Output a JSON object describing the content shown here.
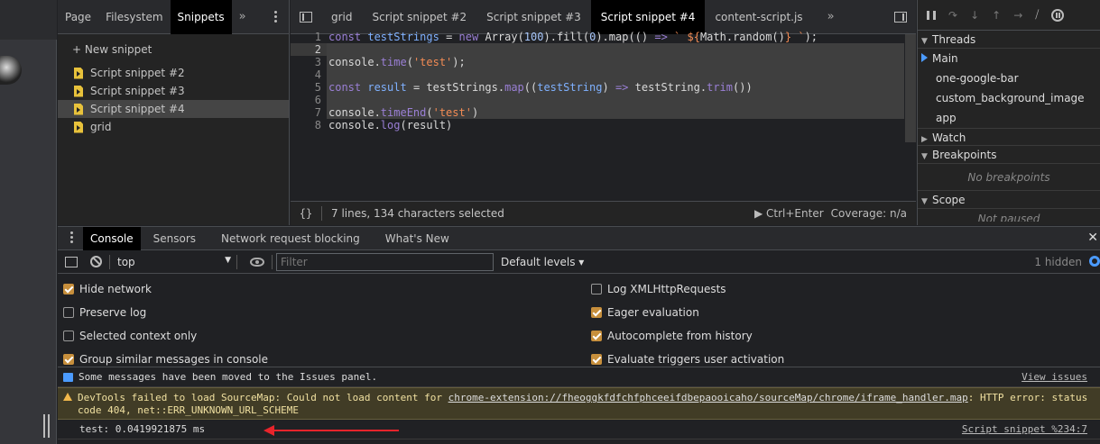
{
  "navigator": {
    "tabs": [
      "Page",
      "Filesystem",
      "Snippets"
    ],
    "active_tab": "Snippets",
    "new_snippet": "+ New snippet",
    "snippets": [
      "Script snippet #2",
      "Script snippet #3",
      "Script snippet #4",
      "grid"
    ],
    "selected_snippet": "Script snippet #4"
  },
  "editor": {
    "tabs": [
      "grid",
      "Script snippet #2",
      "Script snippet #3",
      "Script snippet #4",
      "content-script.js"
    ],
    "active_tab": "Script snippet #4",
    "line_numbers": [
      "1",
      "2",
      "3",
      "4",
      "5",
      "6",
      "7",
      "8"
    ],
    "status": {
      "braces": "{}",
      "selection": "7 lines, 134 characters selected",
      "run": "Ctrl+Enter",
      "coverage": "Coverage: n/a"
    }
  },
  "debugger": {
    "threads_label": "Threads",
    "threads": [
      "Main",
      "one-google-bar",
      "custom_background_image",
      "app"
    ],
    "watch_label": "Watch",
    "breakpoints_label": "Breakpoints",
    "no_breakpoints": "No breakpoints",
    "scope_label": "Scope",
    "not_paused": "Not paused"
  },
  "drawer": {
    "tabs": [
      "Console",
      "Sensors",
      "Network request blocking",
      "What's New"
    ],
    "active_tab": "Console",
    "context": "top",
    "filter_placeholder": "Filter",
    "levels": "Default levels ▾",
    "hidden": "1 hidden",
    "settings_left": [
      {
        "label": "Hide network",
        "checked": true
      },
      {
        "label": "Preserve log",
        "checked": false
      },
      {
        "label": "Selected context only",
        "checked": false
      },
      {
        "label": "Group similar messages in console",
        "checked": true
      }
    ],
    "settings_right": [
      {
        "label": "Log XMLHttpRequests",
        "checked": false
      },
      {
        "label": "Eager evaluation",
        "checked": true
      },
      {
        "label": "Autocomplete from history",
        "checked": true
      },
      {
        "label": "Evaluate triggers user activation",
        "checked": true
      }
    ],
    "messages": {
      "info_text": "Some messages have been moved to the Issues panel.",
      "info_link": "View issues",
      "warn_prefix": "DevTools failed to load SourceMap: Could not load content for ",
      "warn_link": "chrome-extension://fheoggkfdfchfphceeifdbepaooicaho/sourceMap/chrome/iframe_handler.map",
      "warn_suffix": ": HTTP error: status code 404, net::ERR_UNKNOWN_URL_SCHEME",
      "log_text": "test: 0.0419921875 ms",
      "log_source": "Script snippet %234:7"
    }
  },
  "colors": {
    "accent": "#4b9bff",
    "warning_bg": "#413c26",
    "checkbox": "#c78f3c",
    "annotation_arrow": "#e8242b"
  }
}
